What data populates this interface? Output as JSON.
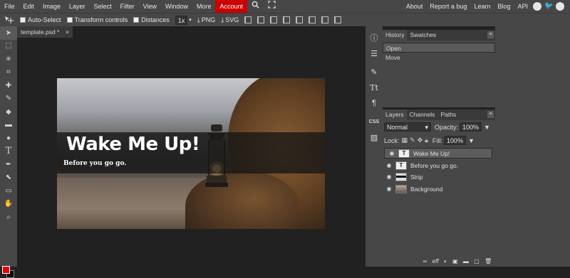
{
  "menu": {
    "items": [
      "File",
      "Edit",
      "Image",
      "Layer",
      "Select",
      "Filter",
      "View",
      "Window",
      "More",
      "Account"
    ],
    "active": "Account",
    "right_items": [
      "About",
      "Report a bug",
      "Learn",
      "Blog",
      "API"
    ]
  },
  "options": {
    "auto_select": "Auto-Select",
    "transform_controls": "Transform controls",
    "distances": "Distances",
    "zoom": "1x",
    "png_label": "PNG",
    "svg_label": "SVG"
  },
  "document": {
    "tab_title": "template.psd *",
    "close": "×",
    "heading": "Wake Me Up!",
    "subheading": "Before you go go."
  },
  "history_panel": {
    "tabs": [
      "History",
      "Swatches"
    ],
    "rows": [
      "Open",
      "Move"
    ]
  },
  "layers_panel": {
    "tabs": [
      "Layers",
      "Channels",
      "Paths"
    ],
    "blend_mode": "Normal",
    "opacity_label": "Opacity:",
    "opacity_value": "100%",
    "lock_label": "Lock:",
    "fill_label": "Fill:",
    "fill_value": "100%",
    "layers": [
      {
        "name": "Wake Me Up!",
        "type": "text",
        "selected": true
      },
      {
        "name": "Before you go go.",
        "type": "text",
        "selected": false
      },
      {
        "name": "Strip",
        "type": "shape",
        "selected": false
      },
      {
        "name": "Background",
        "type": "image",
        "selected": false
      }
    ],
    "bottom_icons": [
      "link-icon",
      "effects-icon",
      "adjustment-icon",
      "mask-icon",
      "folder-icon",
      "new-layer-icon",
      "delete-icon"
    ],
    "effects_label": "eff"
  },
  "icon_panel": {
    "css_label": "CSS"
  },
  "colors": {
    "foreground": "#e60000",
    "background": "#000000",
    "accent": "#cc0000"
  }
}
